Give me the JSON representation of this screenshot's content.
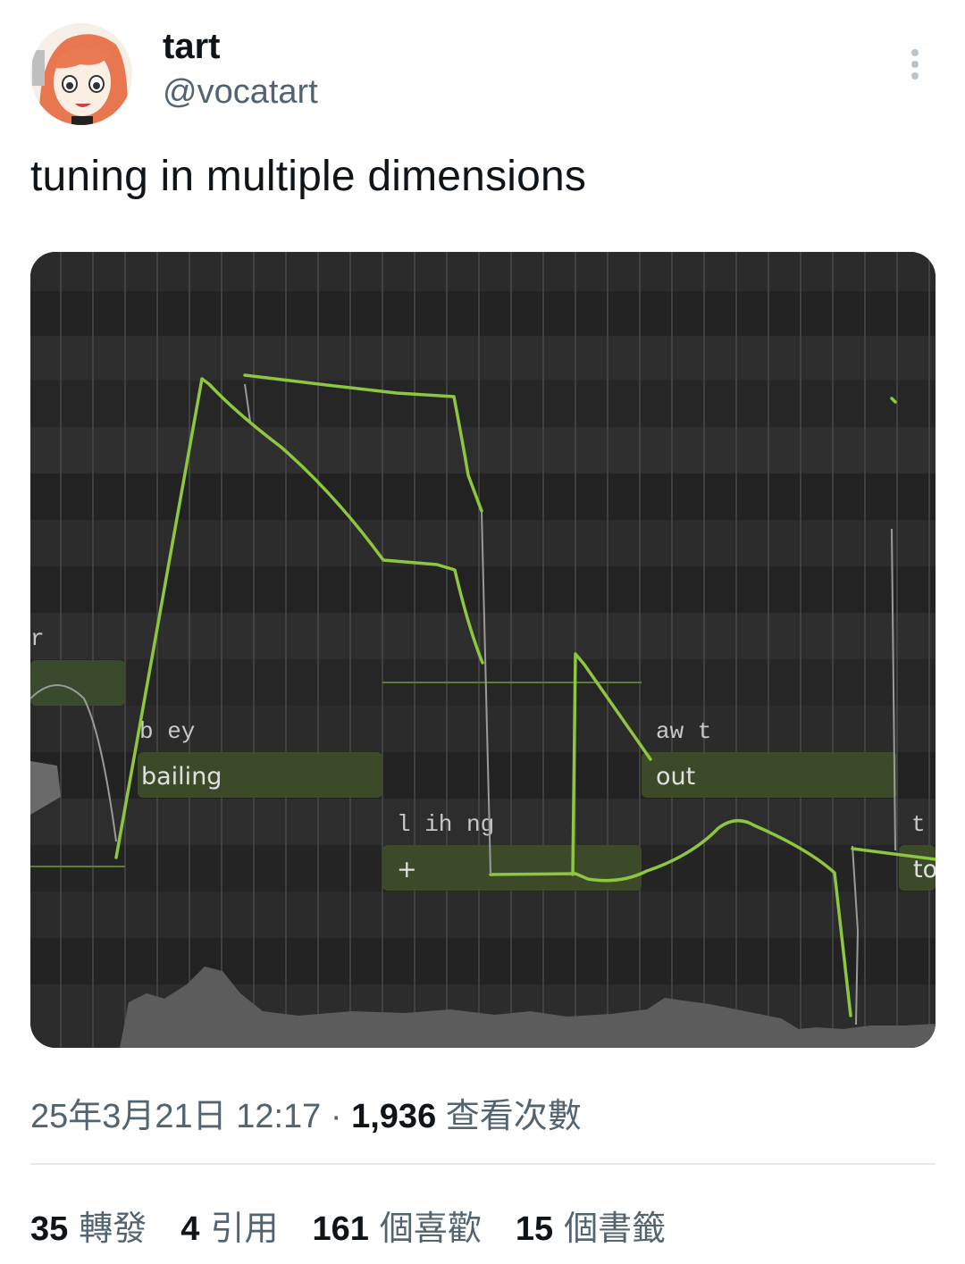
{
  "author": {
    "display_name": "tart",
    "handle": "@vocatart",
    "avatar_icon": "anime-avatar-icon"
  },
  "more_icon": "more-vertical-icon",
  "tweet": {
    "text": "tuning in multiple dimensions"
  },
  "media": {
    "description_icon": "pitch-editor-screenshot",
    "phonemes": [
      "r",
      "b ey",
      "aw t",
      "l ih ng",
      "t u"
    ],
    "lyrics": [
      "bailing",
      "out",
      "+",
      "to"
    ],
    "colors": {
      "background": "#262626",
      "note": "#3d4a2a",
      "pitch_curve": "#8dc63f",
      "grid": "#4a4a4a"
    }
  },
  "meta": {
    "date_time": "25年3月21日 12:17",
    "separator": "·",
    "views": "1,936",
    "views_label": "查看次數"
  },
  "stats": [
    {
      "count": "35",
      "label": "轉發"
    },
    {
      "count": "4",
      "label": "引用"
    },
    {
      "count": "161",
      "label": "個喜歡"
    },
    {
      "count": "15",
      "label": "個書籤"
    }
  ]
}
